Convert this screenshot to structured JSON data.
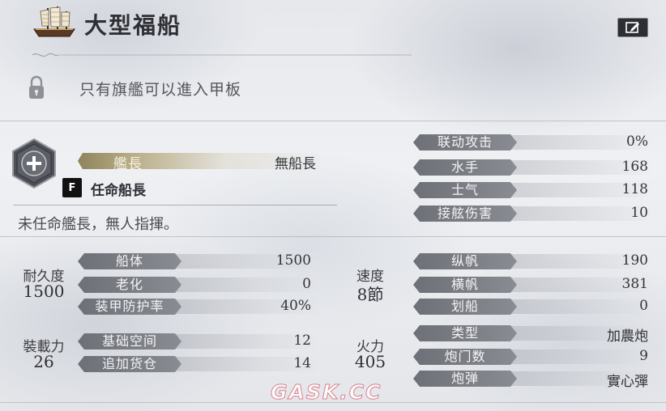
{
  "ship": {
    "name": "大型福船"
  },
  "notice": {
    "lock_text": "只有旗艦可以進入甲板"
  },
  "captain": {
    "label": "艦長",
    "value": "無船長",
    "hotkey": "F",
    "appoint_label": "任命船長",
    "description": "未任命艦長，無人指揮。"
  },
  "left_stats": {
    "durability": {
      "label": "耐久度",
      "value": "1500",
      "rows": [
        {
          "label": "船体",
          "value": "1500"
        },
        {
          "label": "老化",
          "value": "0"
        },
        {
          "label": "装甲防护率",
          "value": "40%"
        }
      ]
    },
    "capacity": {
      "label": "裝載力",
      "value": "26",
      "rows": [
        {
          "label": "基础空间",
          "value": "12"
        },
        {
          "label": "追加货仓",
          "value": "14"
        }
      ]
    }
  },
  "right_top_stats": [
    {
      "label": "联动攻击",
      "value": "0%"
    },
    {
      "label": "水手",
      "value": "168"
    },
    {
      "label": "士气",
      "value": "118"
    },
    {
      "label": "接舷伤害",
      "value": "10"
    }
  ],
  "right_stats": {
    "speed": {
      "label": "速度",
      "value": "8節",
      "rows": [
        {
          "label": "纵帆",
          "value": "190"
        },
        {
          "label": "横帆",
          "value": "381"
        },
        {
          "label": "划船",
          "value": "0"
        }
      ]
    },
    "firepower": {
      "label": "火力",
      "value": "405",
      "rows": [
        {
          "label": "类型",
          "value": "加農炮"
        },
        {
          "label": "炮门数",
          "value": "9"
        },
        {
          "label": "炮弹",
          "value": "實心彈"
        }
      ]
    }
  },
  "watermark": "GASK.CC",
  "colors": {
    "pill": "#767880",
    "captain_bar": "#a89c74",
    "background": "#e8eaee"
  },
  "icons": {
    "ship": "ship-icon",
    "edit": "edit-icon",
    "lock": "lock-icon",
    "plus": "plus-icon"
  }
}
